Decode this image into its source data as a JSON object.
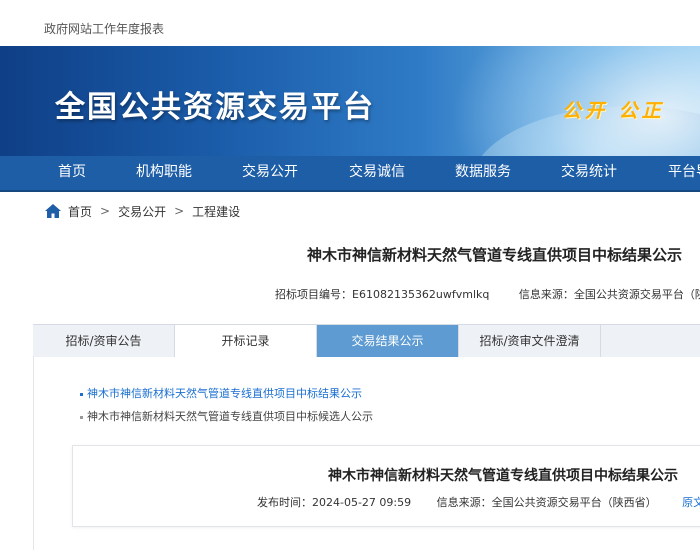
{
  "topbar": {
    "text": "政府网站工作年度报表"
  },
  "banner": {
    "title": "全国公共资源交易平台",
    "slogan": "公开 公正"
  },
  "nav": {
    "items": [
      "首页",
      "机构职能",
      "交易公开",
      "交易诚信",
      "数据服务",
      "交易统计",
      "平台导"
    ]
  },
  "breadcrumb": {
    "items": [
      "首页",
      "交易公开",
      "工程建设"
    ],
    "separator": ">"
  },
  "article": {
    "title": "神木市神信新材料天然气管道专线直供项目中标结果公示",
    "project_code": "招标项目编号：E61082135362uwfvmlkq",
    "source": "信息来源：全国公共资源交易平台（陕西"
  },
  "tabs": {
    "items": [
      "招标/资审公告",
      "开标记录",
      "交易结果公示",
      "招标/资审文件澄清"
    ],
    "active_index": 2
  },
  "links": [
    "神木市神信新材料天然气管道专线直供项目中标结果公示",
    "神木市神信新材料天然气管道专线直供项目中标候选人公示"
  ],
  "card": {
    "title": "神木市神信新材料天然气管道专线直供项目中标结果公示",
    "publish_time": "发布时间：2024-05-27 09:59",
    "source": "信息来源：全国公共资源交易平台（陕西省）",
    "original_link": "原文"
  },
  "colors": {
    "nav_bg": "#1d5ea7",
    "tab_active": "#5d9bd2",
    "link_blue": "#1a6fd0",
    "slogan": "#ffb000"
  }
}
